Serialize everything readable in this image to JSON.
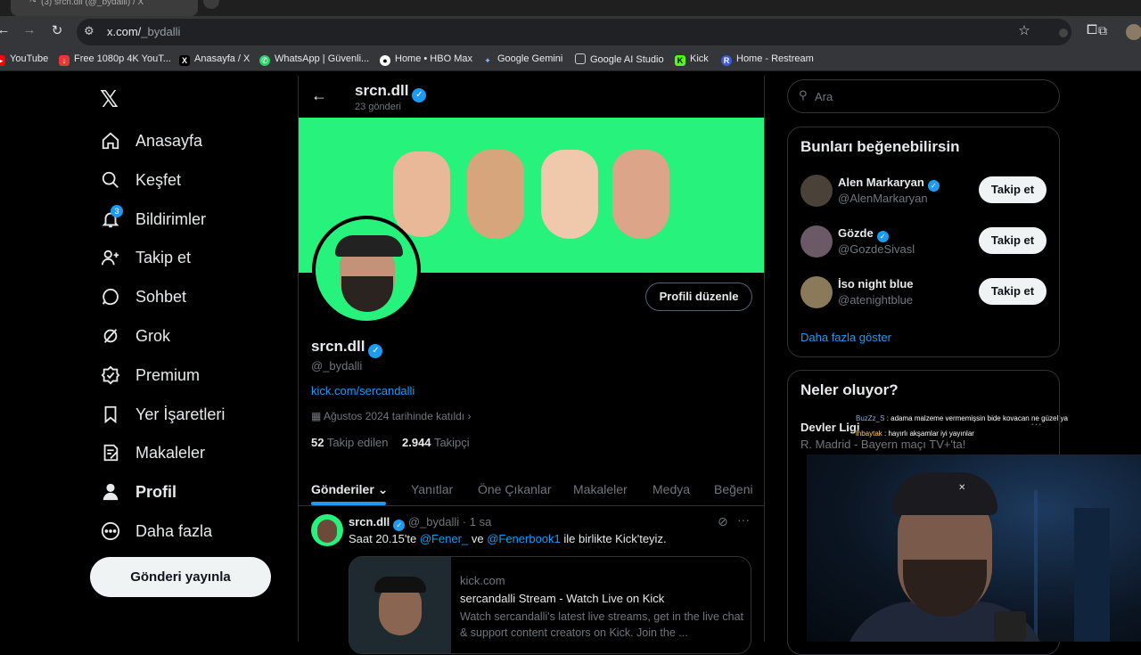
{
  "browser": {
    "tab_title": "(3) srcn.dll (@_bydalli) / X",
    "url_host": "x.com/",
    "url_path": "_bydalli",
    "bookmarks": [
      "YouTube",
      "Free 1080p 4K YouT...",
      "Anasayfa / X",
      "WhatsApp | Güvenli...",
      "Home • HBO Max",
      "Google Gemini",
      "Google AI Studio",
      "Kick",
      "Home - Restream"
    ]
  },
  "nav": {
    "items": [
      {
        "label": "Anasayfa",
        "icon": "home-icon"
      },
      {
        "label": "Keşfet",
        "icon": "search-icon"
      },
      {
        "label": "Bildirimler",
        "icon": "bell-icon",
        "badge": "3"
      },
      {
        "label": "Takip et",
        "icon": "follow-icon"
      },
      {
        "label": "Sohbet",
        "icon": "chat-icon"
      },
      {
        "label": "Grok",
        "icon": "grok-icon"
      },
      {
        "label": "Premium",
        "icon": "premium-icon"
      },
      {
        "label": "Yer İşaretleri",
        "icon": "bookmark-icon"
      },
      {
        "label": "Makaleler",
        "icon": "articles-icon"
      },
      {
        "label": "Profil",
        "icon": "profile-icon"
      },
      {
        "label": "Daha fazla",
        "icon": "more-icon"
      }
    ],
    "post_button": "Gönderi yayınla"
  },
  "profile": {
    "header_name": "srcn.dll",
    "header_posts": "23 gönderi",
    "name": "srcn.dll",
    "handle": "@_bydalli",
    "link": "kick.com/sercandalli",
    "joined": "Ağustos 2024 tarihinde katıldı",
    "following_count": "52",
    "following_label": "Takip edilen",
    "followers_count": "2.944",
    "followers_label": "Takipçi",
    "edit_button": "Profili düzenle",
    "banner_color": "#27f27c",
    "tabs": [
      "Gönderiler",
      "Yanıtlar",
      "Öne Çıkanlar",
      "Makaleler",
      "Medya",
      "Beğeni"
    ]
  },
  "post": {
    "name": "srcn.dll",
    "handle": "@_bydalli",
    "time": "· 1 sa",
    "text_a": "Saat 20.15'te ",
    "mention1": "@Fener_",
    "text_b": " ve ",
    "mention2": "@Fenerbook1",
    "text_c": " ile birlikte Kick'teyiz.",
    "card_domain": "kick.com",
    "card_title": "sercandalli Stream - Watch Live on Kick",
    "card_desc": "Watch sercandalli's latest live streams, get in the live chat & support content creators on Kick. Join the ..."
  },
  "sidebar": {
    "search_placeholder": "Ara",
    "suggest_title": "Bunları beğenebilirsin",
    "suggestions": [
      {
        "name": "Alen Markaryan",
        "handle": "@AlenMarkaryan",
        "verified": true,
        "button": "Takip et"
      },
      {
        "name": "Gözde",
        "handle": "@GozdeSivasl",
        "verified": true,
        "button": "Takip et"
      },
      {
        "name": "İso night blue",
        "handle": "@atenightblue",
        "verified": false,
        "button": "Takip et"
      }
    ],
    "show_more": "Daha fazla göster",
    "trends_title": "Neler oluyor?",
    "trend_name": "Devler Ligi",
    "trend_sub": "R. Madrid - Bayern maçı TV+'ta!"
  },
  "chat_overlay": [
    {
      "user": "BuzZz_S",
      "msg": " : adama malzeme vermemişsin bide kovacan ne güzel ya"
    },
    {
      "user": "lhbaytak",
      "msg": " : hayırlı akşamlar iyi yayınlar"
    }
  ]
}
